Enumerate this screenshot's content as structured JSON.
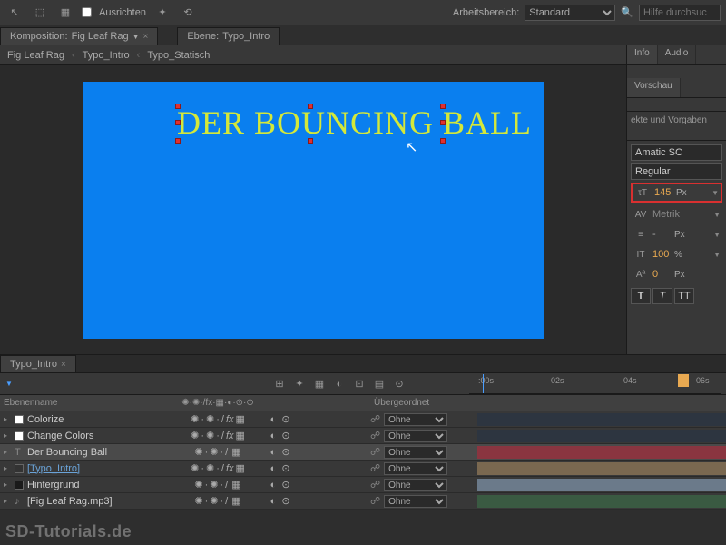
{
  "toolbar": {
    "align": "Ausrichten",
    "workspace_label": "Arbeitsbereich:",
    "workspace_value": "Standard",
    "search_placeholder": "Hilfe durchsuc"
  },
  "comp_panel": {
    "prefix": "Komposition:",
    "name": "Fig Leaf Rag",
    "layer_prefix": "Ebene:",
    "layer_name": "Typo_Intro"
  },
  "breadcrumb": [
    "Fig Leaf Rag",
    "Typo_Intro",
    "Typo_Statisch"
  ],
  "canvas_text": "DER BOUNCING BALL",
  "right": {
    "tabs1": [
      "Info",
      "Audio"
    ],
    "tabs2": [
      "Vorschau"
    ],
    "effects_label": "ekte und Vorgaben",
    "font": "Amatic SC",
    "style": "Regular",
    "size": "145",
    "size_unit": "Px",
    "kerning": "Metrik",
    "leading": "-",
    "leading_unit": "Px",
    "scale": "100",
    "scale_unit": "%",
    "baseline": "0",
    "baseline_unit": "Px",
    "style_bold": "T",
    "style_italic": "T",
    "style_caps": "TT"
  },
  "timeline": {
    "tab": "Typo_Intro",
    "header": {
      "c1": "Ebenenname",
      "c3": "",
      "c4": "Übergeordnet"
    },
    "ruler": [
      ":00s",
      "02s",
      "04s",
      "06s"
    ],
    "layers": [
      {
        "name": "Colorize",
        "swatch": "#ffffff",
        "fx": true,
        "parent": "Ohne",
        "bar": "#2d3540"
      },
      {
        "name": "Change Colors",
        "swatch": "#ffffff",
        "fx": true,
        "parent": "Ohne",
        "bar": "#2d3540"
      },
      {
        "name": "Der Bouncing Ball",
        "swatch": "#333333",
        "type": "T",
        "sel": true,
        "parent": "Ohne",
        "bar": "#8a3540"
      },
      {
        "name": "[Typo_Intro]",
        "swatch": "#333333",
        "link": true,
        "fx": true,
        "parent": "Ohne",
        "bar": "#7a6850"
      },
      {
        "name": "Hintergrund",
        "swatch": "#1a1a1a",
        "parent": "Ohne",
        "bar": "#6b7a8a"
      },
      {
        "name": "[Fig Leaf Rag.mp3]",
        "swatch": "#4a7aa8",
        "type": "audio",
        "parent": "Ohne",
        "bar": "#3a5a42"
      }
    ]
  },
  "watermark": "SD-Tutorials.de"
}
